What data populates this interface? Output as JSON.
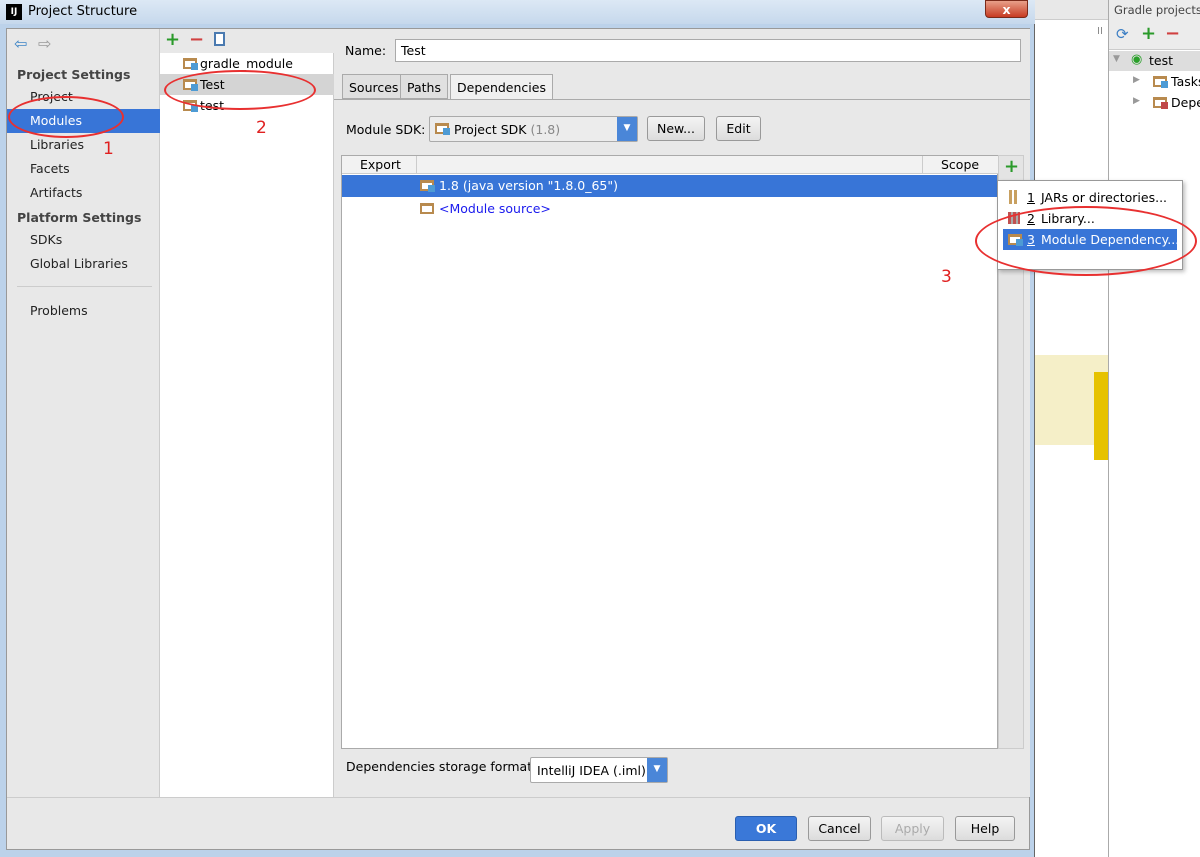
{
  "window": {
    "title": "Project Structure",
    "logo": "IJ",
    "close_label": "x"
  },
  "nav": {
    "back_icon": "arrow-left-icon",
    "forward_icon": "arrow-right-icon",
    "project_settings_header": "Project Settings",
    "project_items": [
      {
        "label": "Project"
      },
      {
        "label": "Modules",
        "selected": true
      },
      {
        "label": "Libraries"
      },
      {
        "label": "Facets"
      },
      {
        "label": "Artifacts"
      }
    ],
    "platform_settings_header": "Platform Settings",
    "platform_items": [
      {
        "label": "SDKs"
      },
      {
        "label": "Global Libraries"
      }
    ],
    "problems": "Problems"
  },
  "modules": {
    "items": [
      {
        "label": "gradle_module"
      },
      {
        "label": "Test",
        "selected": true
      },
      {
        "label": "test"
      }
    ]
  },
  "detail": {
    "name_label": "Name:",
    "name_value": "Test",
    "tabs": [
      {
        "label": "Sources"
      },
      {
        "label": "Paths"
      },
      {
        "label": "Dependencies",
        "active": true
      }
    ],
    "sdk_label": "Module SDK:",
    "sdk_value": "Project SDK",
    "sdk_version": "(1.8)",
    "new_button": "New...",
    "edit_button": "Edit",
    "columns": {
      "export": "Export",
      "scope": "Scope"
    },
    "rows": [
      {
        "label": "1.8 (java version \"1.8.0_65\")",
        "selected": true
      },
      {
        "label": "<Module source>"
      }
    ],
    "storage_label": "Dependencies storage format:",
    "storage_value": "IntelliJ IDEA (.iml)"
  },
  "popup": {
    "items": [
      {
        "num": "1",
        "label": "JARs or directories..."
      },
      {
        "num": "2",
        "label": "Library..."
      },
      {
        "num": "3",
        "label": "Module Dependency...",
        "selected": true
      }
    ]
  },
  "buttons": {
    "ok": "OK",
    "cancel": "Cancel",
    "apply": "Apply",
    "help": "Help"
  },
  "gradle": {
    "title": "Gradle projects",
    "root": "test",
    "children": [
      {
        "label": "Tasks"
      },
      {
        "label": "Depe"
      }
    ]
  },
  "annotations": [
    "1",
    "2",
    "3"
  ],
  "colors": {
    "selection": "#3875d7",
    "annotation": "#e83030"
  }
}
